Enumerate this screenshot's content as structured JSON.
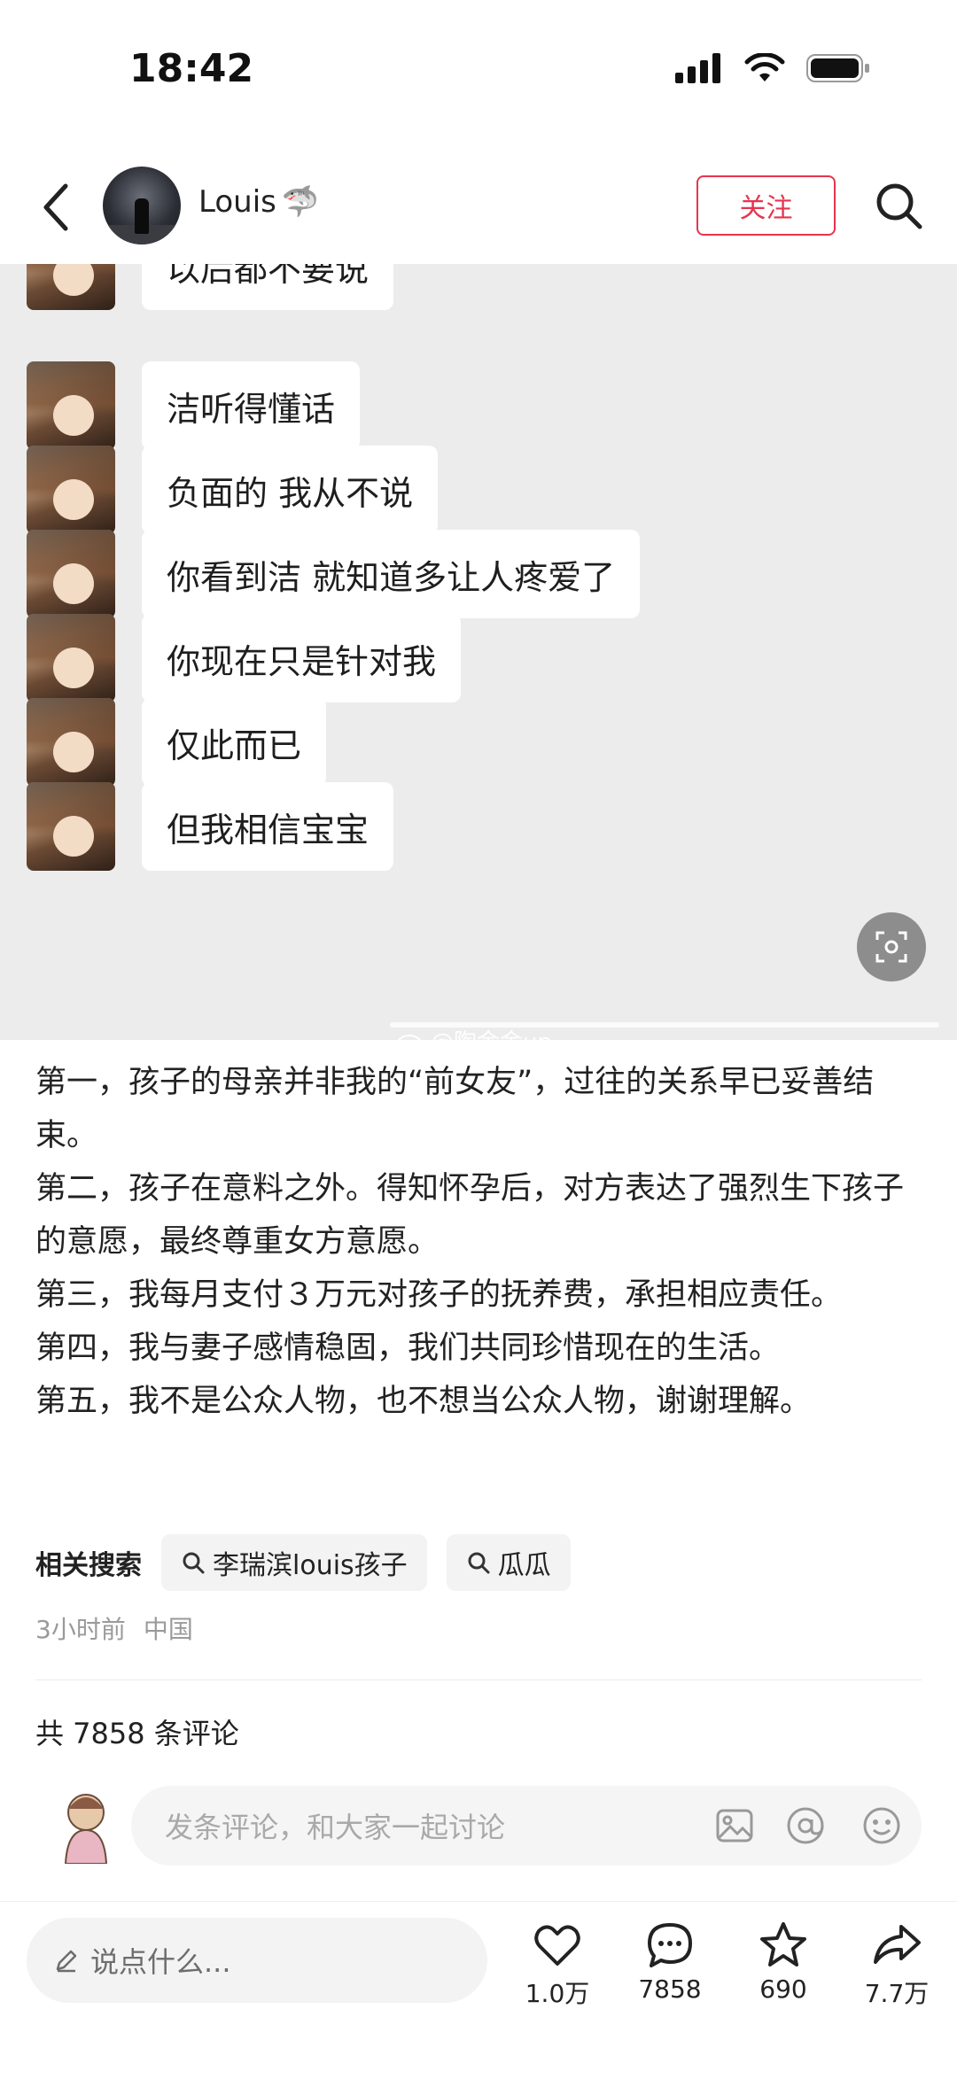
{
  "status_bar": {
    "time": "18:42"
  },
  "header": {
    "username": "Louis",
    "username_emoji": "🦈",
    "follow_label": "关注"
  },
  "chat_messages": [
    "以后都不要说",
    "洁听得懂话",
    "负面的 我从不说",
    "你看到洁 就知道多让人疼爱了",
    "你现在只是针对我",
    "仅此而已",
    "但我相信宝宝"
  ],
  "watermark": "@陶金金up",
  "post": {
    "paragraphs": [
      "第一，孩子的母亲并非我的“前女友”，过往的关系早已妥善结束。",
      "第二，孩子在意料之外。得知怀孕后，对方表达了强烈生下孩子的意愿，最终尊重女方意愿。",
      "第三，我每月支付３万元对孩子的抚养费，承担相应责任。",
      "第四，我与妻子感情稳固，我们共同珍惜现在的生活。",
      "第五，我不是公众人物，也不想当公众人物，谢谢理解。"
    ]
  },
  "related": {
    "label": "相关搜索",
    "chips": [
      "李瑞滨louis孩子",
      "瓜瓜"
    ]
  },
  "meta": {
    "time_ago": "3小时前",
    "location": "中国"
  },
  "comments": {
    "count_text": "共 7858 条评论",
    "input_placeholder": "发条评论，和大家一起讨论"
  },
  "bottom_bar": {
    "say_placeholder": "说点什么...",
    "likes": "1.0万",
    "comments": "7858",
    "favorites": "690",
    "shares": "7.7万"
  },
  "colors": {
    "accent": "#e5354e",
    "image_bg": "#ececec"
  }
}
